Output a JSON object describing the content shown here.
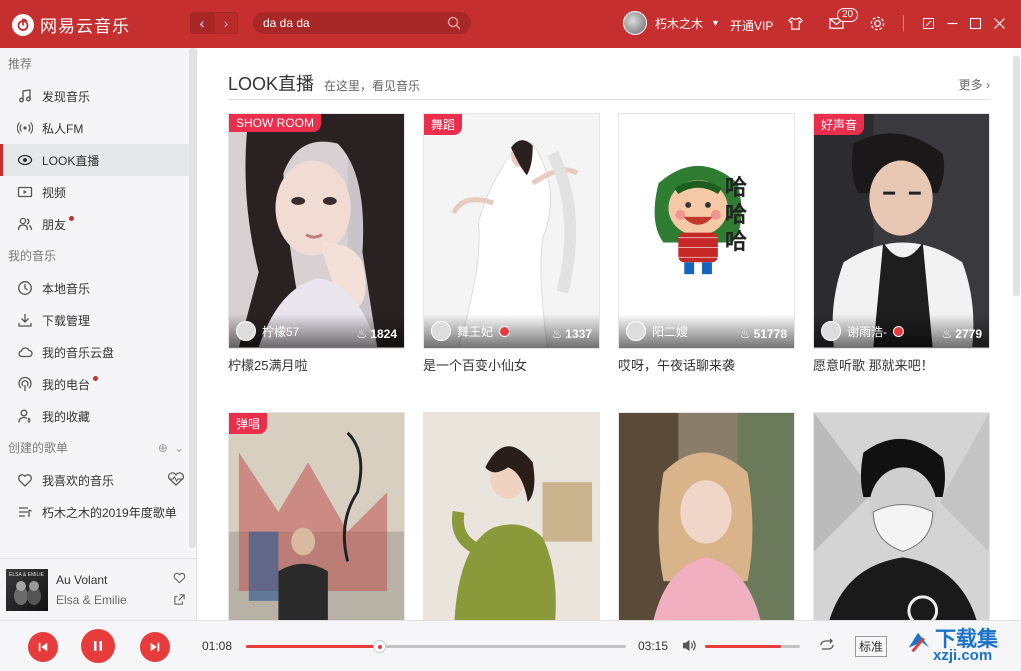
{
  "app": {
    "name": "网易云音乐"
  },
  "header": {
    "search_value": "da da da",
    "username": "朽木之木",
    "vip_label": "开通VIP",
    "msg_count": "20"
  },
  "sidebar": {
    "sections": [
      {
        "title": "推荐",
        "items": [
          {
            "label": "发现音乐",
            "icon": "music-note-icon"
          },
          {
            "label": "私人FM",
            "icon": "radio-icon"
          },
          {
            "label": "LOOK直播",
            "icon": "live-icon",
            "active": true
          },
          {
            "label": "视频",
            "icon": "video-icon"
          },
          {
            "label": "朋友",
            "icon": "friends-icon",
            "dot": true
          }
        ]
      },
      {
        "title": "我的音乐",
        "items": [
          {
            "label": "本地音乐",
            "icon": "clock-icon"
          },
          {
            "label": "下载管理",
            "icon": "download-icon"
          },
          {
            "label": "我的音乐云盘",
            "icon": "cloud-icon"
          },
          {
            "label": "我的电台",
            "icon": "podcast-icon",
            "dot": true
          },
          {
            "label": "我的收藏",
            "icon": "user-star-icon"
          }
        ]
      },
      {
        "title": "创建的歌单",
        "items": [
          {
            "label": "我喜欢的音乐",
            "icon": "heart-icon"
          },
          {
            "label": "朽木之木的2019年度歌单",
            "icon": "playlist-icon"
          }
        ]
      }
    ]
  },
  "now_playing": {
    "title": "Au Volant",
    "artist": "Elsa & Emilie",
    "album_text": "ELSA & EMILIE"
  },
  "main": {
    "title": "LOOK直播",
    "subtitle": "在这里，看见音乐",
    "more": "更多",
    "cards": [
      {
        "tag": "SHOW ROOM",
        "host": "柠檬57",
        "viewers": "1824",
        "title": "柠檬25满月啦",
        "live": false
      },
      {
        "tag": "舞蹈",
        "host": "舞王妃",
        "viewers": "1337",
        "title": "是一个百变小仙女",
        "live": true
      },
      {
        "tag": "",
        "host": "阳二嫂",
        "viewers": "51778",
        "title": "哎呀，午夜话聊来袭",
        "live": false,
        "sticker": "哈哈哈"
      },
      {
        "tag": "好声音",
        "host": "谢雨浩-",
        "viewers": "2779",
        "title": "愿意听歌 那就来吧！",
        "live": true
      },
      {
        "tag": "弹唱",
        "host": "",
        "viewers": "",
        "title": "",
        "live": false
      },
      {
        "tag": "",
        "host": "",
        "viewers": "",
        "title": "",
        "live": false
      },
      {
        "tag": "",
        "host": "",
        "viewers": "",
        "title": "",
        "live": false
      },
      {
        "tag": "",
        "host": "",
        "viewers": "",
        "title": "",
        "live": false
      }
    ]
  },
  "player": {
    "current_time": "01:08",
    "total_time": "03:15",
    "progress": 0.35,
    "volume": 0.8,
    "quality": "标准"
  },
  "watermark": {
    "text": "下载集",
    "url": "xzji.com"
  },
  "colors": {
    "brand": "#c62f2f",
    "accent": "#e83c3c",
    "tag": "#ea2e4c"
  }
}
